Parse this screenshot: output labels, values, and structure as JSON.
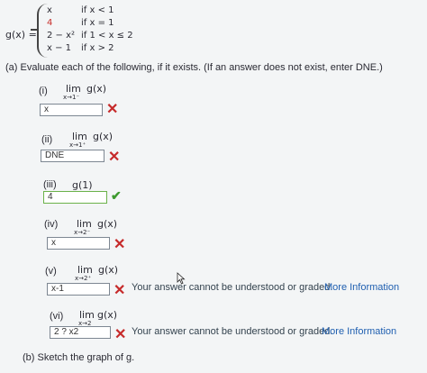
{
  "piecewise": {
    "lhs": "g(x) =",
    "cases": [
      {
        "expr": "x",
        "cond": "if x < 1",
        "highlight": false
      },
      {
        "expr": "4",
        "cond": "if x = 1",
        "highlight": true
      },
      {
        "expr": "2 − x²",
        "cond": "if 1 < x ≤ 2",
        "highlight": false
      },
      {
        "expr": "x − 1",
        "cond": "if x > 2",
        "highlight": false
      }
    ]
  },
  "part_a": {
    "instruction": "(a) Evaluate each of the following, if it exists. (If an answer does not exist, enter DNE.)",
    "items": [
      {
        "label": "(i)",
        "lim": "lim",
        "sub": "x→1⁻",
        "func": "g(x)",
        "answer": "x",
        "status": "incorrect"
      },
      {
        "label": "(ii)",
        "lim": "lim",
        "sub": "x→1⁺",
        "func": "g(x)",
        "answer": "DNE",
        "status": "incorrect"
      },
      {
        "label": "(iii)",
        "lim": "",
        "sub": "",
        "func": "g(1)",
        "answer": "4",
        "status": "correct"
      },
      {
        "label": "(iv)",
        "lim": "lim",
        "sub": "x→2⁻",
        "func": "g(x)",
        "answer": "x",
        "status": "incorrect"
      },
      {
        "label": "(v)",
        "lim": "lim",
        "sub": "x→2⁺",
        "func": "g(x)",
        "answer": "x-1",
        "status": "incorrect"
      },
      {
        "label": "(vi)",
        "lim": "lim",
        "sub": "x→2",
        "func": "g(x)",
        "answer": "2 ? x2",
        "status": "incorrect"
      }
    ],
    "error_message": "Your answer cannot be understood or graded.",
    "more_info_link": "More Information",
    "incorrect_icon": "x-mark-icon",
    "correct_icon": "check-mark-icon"
  },
  "part_b": {
    "instruction": "(b) Sketch the graph of g."
  },
  "colors": {
    "background": "#f3f5f6",
    "incorrect": "#c62a2a",
    "correct": "#3d9a2f",
    "link": "#1f5fb0"
  }
}
